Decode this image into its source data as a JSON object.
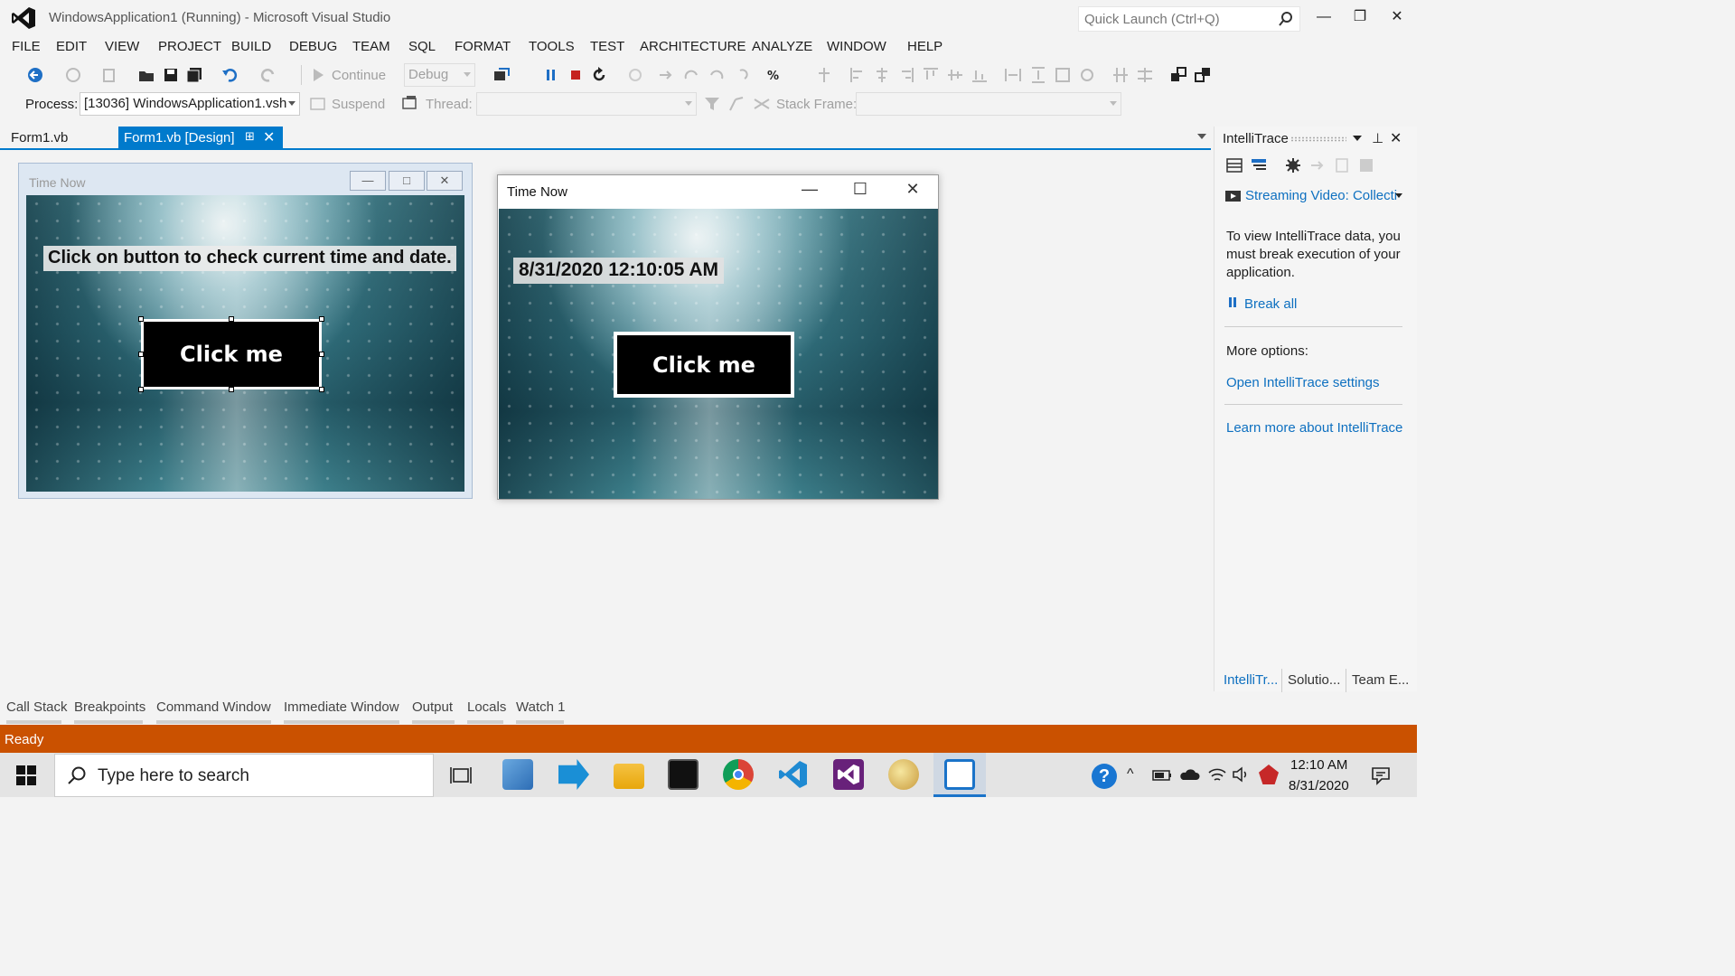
{
  "window": {
    "title": "WindowsApplication1 (Running) - Microsoft Visual Studio",
    "quick_launch_placeholder": "Quick Launch (Ctrl+Q)"
  },
  "menu": [
    "FILE",
    "EDIT",
    "VIEW",
    "PROJECT",
    "BUILD",
    "DEBUG",
    "TEAM",
    "SQL",
    "FORMAT",
    "TOOLS",
    "TEST",
    "ARCHITECTURE",
    "ANALYZE",
    "WINDOW",
    "HELP"
  ],
  "toolbar": {
    "continue_label": "Continue",
    "config_value": "Debug",
    "process_label": "Process:",
    "process_value": "[13036] WindowsApplication1.vsh",
    "suspend_label": "Suspend",
    "thread_label": "Thread:",
    "stack_frame_label": "Stack Frame:"
  },
  "tabs": [
    {
      "label": "Form1.vb"
    },
    {
      "label": "Form1.vb [Design]"
    }
  ],
  "design_form": {
    "title": "Time Now",
    "label": "Click on button to check current time and date.",
    "button": "Click me"
  },
  "running_form": {
    "title": "Time Now",
    "label": "8/31/2020 12:10:05 AM",
    "button": "Click me"
  },
  "intellitrace": {
    "title": "IntelliTrace",
    "streaming_video": "Streaming Video: Collecti",
    "info": "To view IntelliTrace data, you must break execution of your application.",
    "break_all": "Break all",
    "more_options": "More options:",
    "open_settings": "Open IntelliTrace settings",
    "learn_more": "Learn more about IntelliTrace",
    "bottom_tabs": [
      "IntelliTr...",
      "Solutio...",
      "Team E..."
    ]
  },
  "tool_tabs": [
    "Call Stack",
    "Breakpoints",
    "Command Window",
    "Immediate Window",
    "Output",
    "Locals",
    "Watch 1"
  ],
  "status": "Ready",
  "taskbar": {
    "search_placeholder": "Type here to search",
    "time": "12:10 AM",
    "date": "8/31/2020"
  },
  "colors": {
    "accent": "#007acc",
    "status_bar": "#ca5100",
    "link": "#0e70c0"
  }
}
